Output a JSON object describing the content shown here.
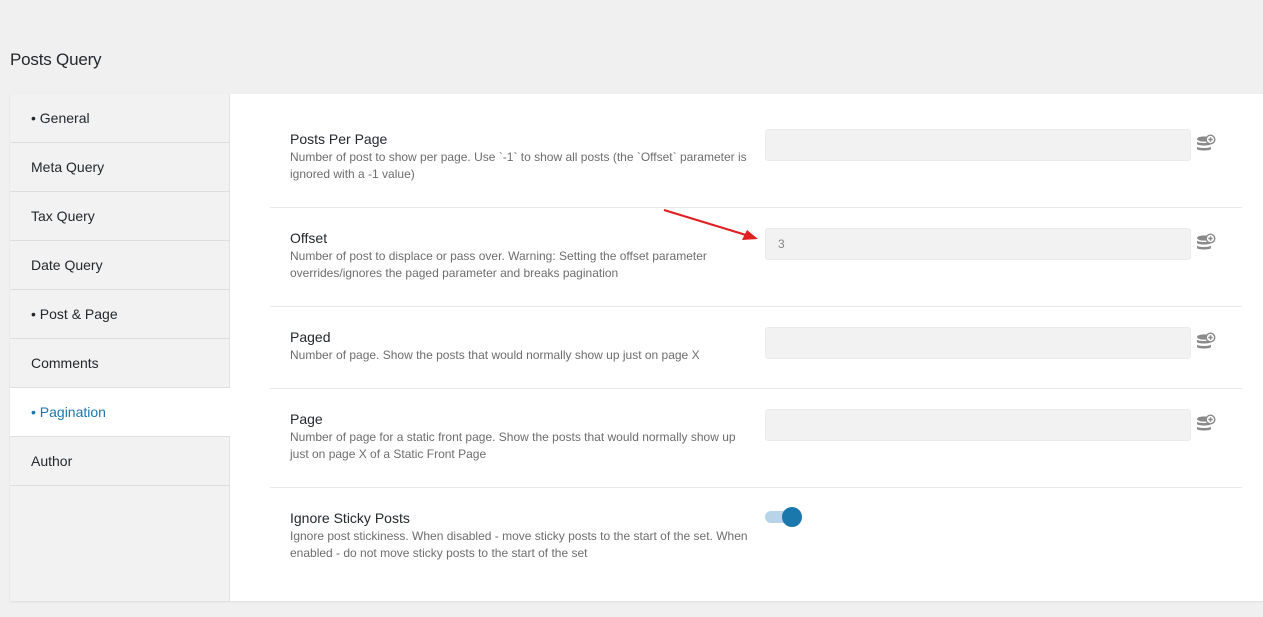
{
  "page": {
    "title": "Posts Query"
  },
  "sidebar": {
    "tabs": [
      {
        "label": "• General",
        "active": false
      },
      {
        "label": "Meta Query",
        "active": false
      },
      {
        "label": "Tax Query",
        "active": false
      },
      {
        "label": "Date Query",
        "active": false
      },
      {
        "label": "• Post & Page",
        "active": false
      },
      {
        "label": "Comments",
        "active": false
      },
      {
        "label": "• Pagination",
        "active": true
      },
      {
        "label": "Author",
        "active": false
      }
    ]
  },
  "settings": {
    "posts_per_page": {
      "label": "Posts Per Page",
      "description": "Number of post to show per page. Use `-1` to show all posts (the `Offset` parameter is ignored with a -1 value)",
      "value": ""
    },
    "offset": {
      "label": "Offset",
      "description": "Number of post to displace or pass over. Warning: Setting the offset parameter overrides/ignores the paged parameter and breaks pagination",
      "value": "3"
    },
    "paged": {
      "label": "Paged",
      "description": "Number of page. Show the posts that would normally show up just on page X",
      "value": ""
    },
    "page": {
      "label": "Page",
      "description": "Number of page for a static front page. Show the posts that would normally show up just on page X of a Static Front Page",
      "value": ""
    },
    "ignore_sticky_posts": {
      "label": "Ignore Sticky Posts",
      "description": "Ignore post stickiness. When disabled - move sticky posts to the start of the set. When enabled - do not move sticky posts to the start of the set",
      "enabled": true
    }
  },
  "icons": {
    "dynamic_data": "database-plus-icon",
    "annotation": "red-arrow-icon"
  },
  "colors": {
    "accent": "#1a78ad",
    "annotation_arrow": "#e02020"
  }
}
